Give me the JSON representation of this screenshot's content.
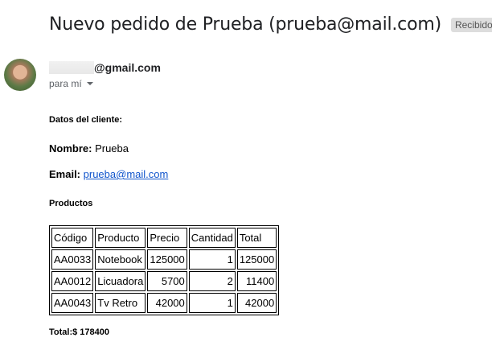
{
  "email": {
    "subject": "Nuevo pedido de Prueba (prueba@mail.com)",
    "label": "Recibidos",
    "label_close": "×",
    "sender_domain": "@gmail.com",
    "recipient": "para mí"
  },
  "body": {
    "client_heading": "Datos del cliente:",
    "name_label": "Nombre:",
    "name_value": "Prueba",
    "email_label": "Email:",
    "email_value": "prueba@mail.com",
    "products_heading": "Productos",
    "table": {
      "headers": [
        "Código",
        "Producto",
        "Precio",
        "Cantidad",
        "Total"
      ],
      "rows": [
        [
          "AA0033",
          "Notebook",
          "125000",
          "1",
          "125000"
        ],
        [
          "AA0012",
          "Licuadora",
          "5700",
          "2",
          "11400"
        ],
        [
          "AA0043",
          "Tv Retro",
          "42000",
          "1",
          "42000"
        ]
      ]
    },
    "total_label": "Total:",
    "total_value": "$ 178400"
  }
}
